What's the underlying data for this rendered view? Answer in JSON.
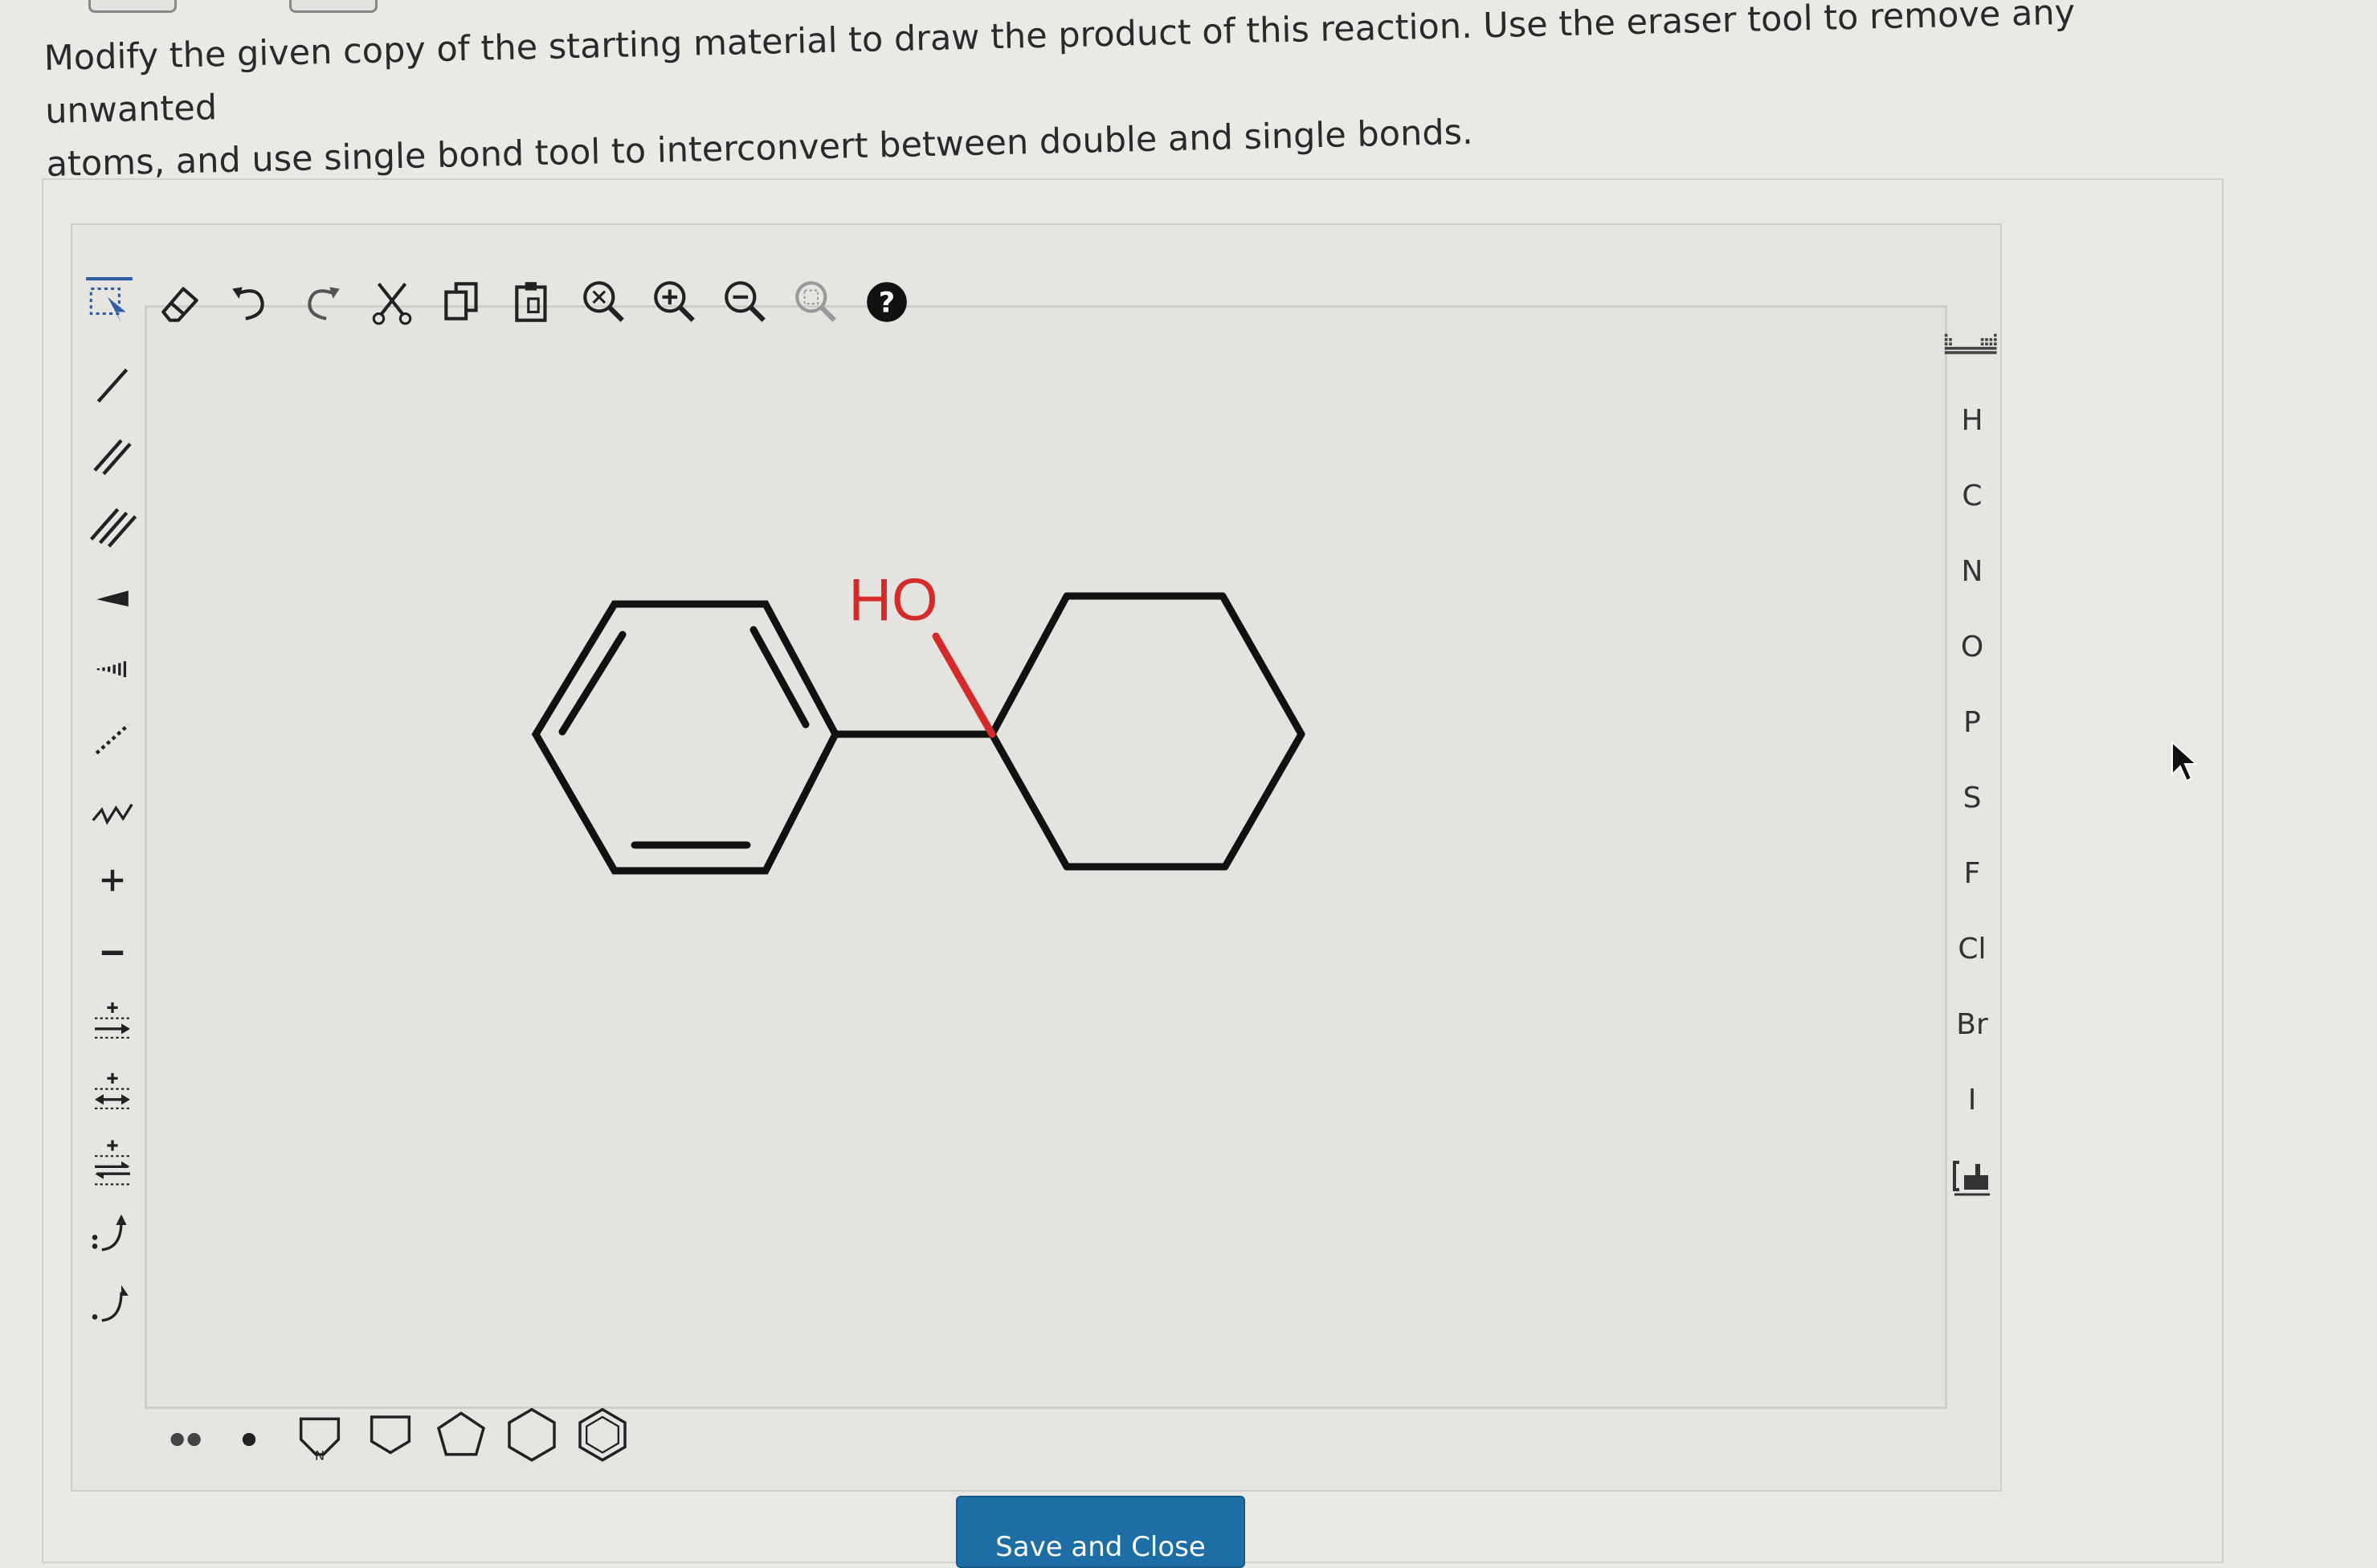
{
  "instructions": {
    "line1": "Modify the given copy of the starting material to draw the product of this reaction. Use the eraser tool to remove any unwanted",
    "line2": "atoms, and use single bond tool to interconvert between double and single bonds."
  },
  "top_toolbar": [
    {
      "name": "select-tool",
      "icon": "select-icon"
    },
    {
      "name": "eraser-tool",
      "icon": "eraser-icon"
    },
    {
      "name": "undo",
      "icon": "undo-icon"
    },
    {
      "name": "redo",
      "icon": "redo-icon"
    },
    {
      "name": "cut",
      "icon": "scissors-icon"
    },
    {
      "name": "copy",
      "icon": "copy-icon"
    },
    {
      "name": "paste",
      "icon": "paste-icon"
    },
    {
      "name": "zoom-clear",
      "icon": "zoom-clear-icon"
    },
    {
      "name": "zoom-in",
      "icon": "zoom-in-icon"
    },
    {
      "name": "zoom-out",
      "icon": "zoom-out-icon"
    },
    {
      "name": "zoom-fit",
      "icon": "zoom-fit-icon"
    },
    {
      "name": "help",
      "icon": "help-icon"
    }
  ],
  "left_toolbar": [
    {
      "name": "single-bond",
      "icon": "single-bond-icon"
    },
    {
      "name": "double-bond",
      "icon": "double-bond-icon"
    },
    {
      "name": "triple-bond",
      "icon": "triple-bond-icon"
    },
    {
      "name": "wedge-bond",
      "icon": "wedge-bond-icon"
    },
    {
      "name": "hash-bond",
      "icon": "hash-bond-icon"
    },
    {
      "name": "dashed-bond",
      "icon": "dashed-bond-icon"
    },
    {
      "name": "chain",
      "icon": "chain-icon"
    },
    {
      "name": "positive-charge",
      "icon": "plus-icon"
    },
    {
      "name": "negative-charge",
      "icon": "minus-icon"
    },
    {
      "name": "reaction-arrow",
      "icon": "reaction-arrow-icon"
    },
    {
      "name": "resonance-arrow",
      "icon": "resonance-arrow-icon"
    },
    {
      "name": "equilibrium-arrow",
      "icon": "equilibrium-arrow-icon"
    },
    {
      "name": "electron-pair-arrow",
      "icon": "curved-arrow-pair-icon"
    },
    {
      "name": "single-electron-arrow",
      "icon": "curved-arrow-single-icon"
    }
  ],
  "right_toolbar": {
    "periodic_table_icon": "periodic-table-icon",
    "elements": [
      "H",
      "C",
      "N",
      "O",
      "P",
      "S",
      "F",
      "Cl",
      "Br",
      "I"
    ],
    "bracket_icon": "bracket-icon"
  },
  "bottom_toolbar": [
    {
      "name": "lone-pair",
      "icon": "lone-pair-icon"
    },
    {
      "name": "radical",
      "icon": "radical-icon"
    },
    {
      "name": "pyrrole-ring",
      "icon": "n-ring-icon",
      "label": "N"
    },
    {
      "name": "cyclobutane",
      "icon": "square-icon"
    },
    {
      "name": "cyclopentane",
      "icon": "pentagon-icon"
    },
    {
      "name": "cyclohexane",
      "icon": "hexagon-icon"
    },
    {
      "name": "benzene",
      "icon": "benzene-icon"
    }
  ],
  "molecule": {
    "label": "HO",
    "label_color": "#d42a2a",
    "bond_color": "#111111"
  },
  "save_button": {
    "label": "Save and Close"
  },
  "colors": {
    "accent": "#1c6ea4",
    "select_underline": "#2f5fa8"
  }
}
